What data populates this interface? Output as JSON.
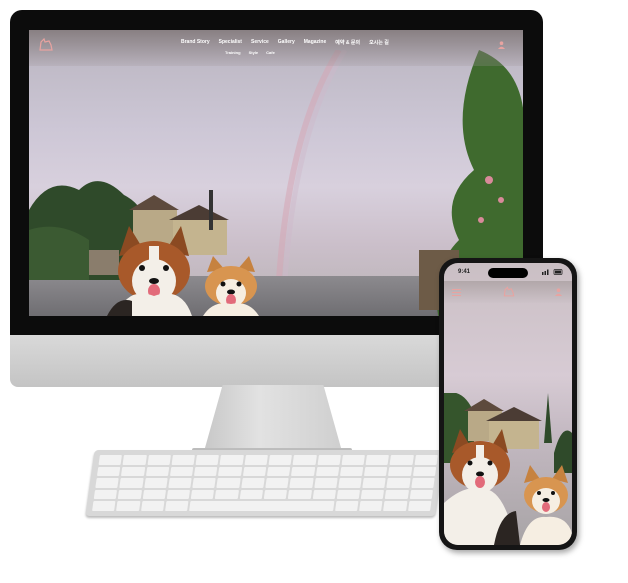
{
  "site": {
    "nav": {
      "items": [
        "Brand Story",
        "Specialist",
        "Service",
        "Gallery",
        "Magazine",
        "예약 & 문의",
        "오시는 길"
      ],
      "sub_items": [
        "Training",
        "Style",
        "Cafe"
      ]
    }
  },
  "phone": {
    "time": "9:41"
  },
  "colors": {
    "accent": "#e8a3a0",
    "bezel": "#0c0c0c",
    "sky": "#cdc7d6"
  }
}
